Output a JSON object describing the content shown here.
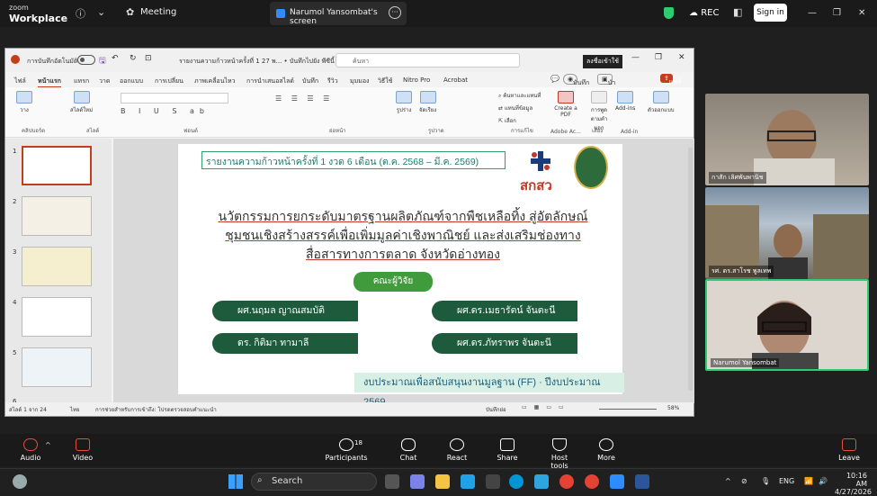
{
  "zoom": {
    "brand": "zoom",
    "product": "Workplace",
    "meeting_label": "Meeting",
    "share_tab": "Narumol Yansombat's screen",
    "rec_label": "REC",
    "signin_label": "Sign in"
  },
  "ppt": {
    "autosave_label": "การบันทึกอัตโนมัติ",
    "file_title": "รายงานความก้าวหน้าครั้งที่ 1 27 พ... • บันทึกไปยัง พีซีนี้",
    "search_placeholder": "ค้นหา",
    "signin_badge": "ลงชื่อเข้าใช้",
    "tabs": [
      "ไฟล์",
      "หน้าแรก",
      "แทรก",
      "วาด",
      "ออกแบบ",
      "การเปลี่ยน",
      "ภาพเคลื่อนไหว",
      "การนำเสนอสไลด์",
      "บันทึก",
      "รีวิว",
      "มุมมอง",
      "วิธีใช้",
      "Nitro Pro",
      "Acrobat"
    ],
    "record_btn": "บันทึก",
    "teams_btn": "นำเสนอใน Teams",
    "share_btn": "แชร์",
    "groups": [
      "คลิปบอร์ด",
      "สไลด์",
      "ฟอนต์",
      "ย่อหน้า",
      "รูปวาด",
      "การแก้ไข",
      "Adobe Ac...",
      "เสียง",
      "Add-in"
    ],
    "ribbon_buttons": {
      "paste": "วาง",
      "new_slide": "สไลด์ใหม่",
      "shapes": "รูปร่าง",
      "arrange": "จัดเรียง",
      "find": "ค้นหาและแทนที่",
      "replace": "แทนที่ข้อมูล",
      "select": "เลือก",
      "create_pdf": "Create a PDF",
      "dictate": "การพูดตามคำบอก",
      "addins": "Add-ins",
      "designer": "ตัวออกแบบ"
    },
    "slide_numbers": [
      "1",
      "2",
      "3",
      "4",
      "5",
      "6"
    ],
    "status": {
      "slide_of": "สไลด์ 1 จาก 24",
      "lang": "ไทย",
      "access": "การช่วยสำหรับการเข้าถึง: โปรดตรวจสอบคำแนะนำ",
      "notes": "บันทึกย่อ",
      "zoom": "58%"
    }
  },
  "slide": {
    "report": "รายงานความก้าวหน้าครั้งที่ 1  งวด 6 เดือน (ต.ค. 2568 – มี.ค. 2569)",
    "agency": "สกสว",
    "title_l1": "นวัตกรรมการยกระดับมาตรฐานผลิตภัณฑ์จากพืชเหลือทิ้ง สู่อัตลักษณ์",
    "title_l2": "ชุมชนเชิงสร้างสรรค์เพื่อเพิ่มมูลค่าเชิงพาณิชย์ และส่งเสริมช่องทาง",
    "title_l3": "สื่อสารทางการตลาด จังหวัดอ่างทอง",
    "team_label": "คณะผู้วิจัย",
    "researchers": [
      "ผศ.นฤมล ญาณสมบัติ",
      "ผศ.ดร.เมธารัตน์  จันตะนี",
      "ดร. กิติมา  ทามาลี",
      "ผศ.ดร.ภัทราพร  จันตะนี"
    ],
    "budget": "งบประมาณเพื่อสนับสนุนงานมูลฐาน (FF) · ปีงบประมาณ 2569"
  },
  "participants": [
    {
      "name": "กาสัก เลิศพันพานิช"
    },
    {
      "name": "รศ. ดร.สาโรช พูลเทพ"
    },
    {
      "name": "Narumol Yansombat"
    }
  ],
  "controls": {
    "audio": "Audio",
    "video": "Video",
    "participants": "Participants",
    "participants_count": "18",
    "chat": "Chat",
    "react": "React",
    "share": "Share",
    "host_tools": "Host tools",
    "more": "More",
    "leave": "Leave"
  },
  "taskbar": {
    "search": "Search",
    "lang": "ENG",
    "time": "10:16 AM",
    "date": "4/27/2026"
  }
}
